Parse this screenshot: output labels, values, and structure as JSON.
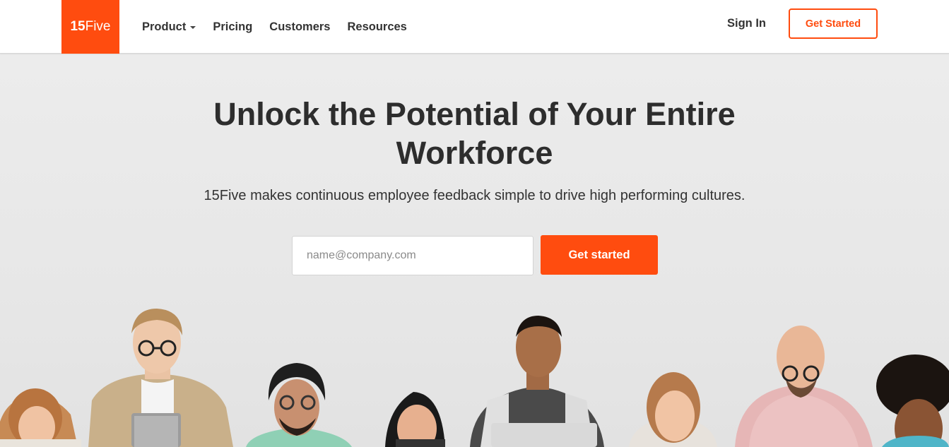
{
  "brand": {
    "logo_bold": "15",
    "logo_light": "Five",
    "accent_color": "#ff4c0f"
  },
  "nav": {
    "items": [
      {
        "label": "Product",
        "dropdown": true
      },
      {
        "label": "Pricing"
      },
      {
        "label": "Customers"
      },
      {
        "label": "Resources"
      }
    ],
    "sign_in": "Sign In",
    "get_started": "Get Started"
  },
  "hero": {
    "headline_line1": "Unlock the Potential of Your Entire",
    "headline_line2": "Workforce",
    "subheadline": "15Five makes continuous employee feedback simple to drive high performing cultures.",
    "email_placeholder": "name@company.com",
    "email_value": "",
    "cta_label": "Get started"
  }
}
